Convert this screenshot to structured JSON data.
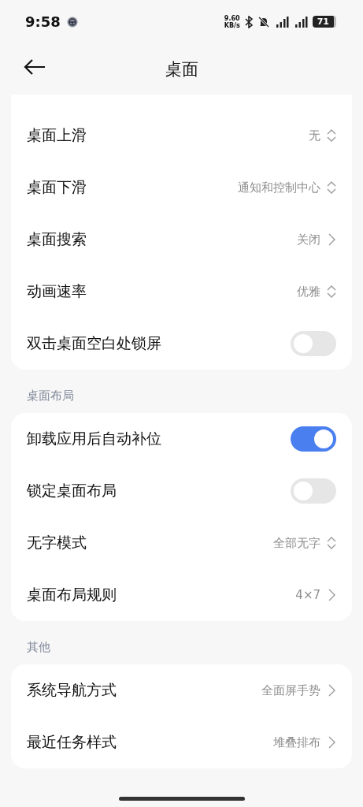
{
  "status_bar": {
    "time": "9:58",
    "net_speed": "9.60",
    "net_unit": "KB/s",
    "battery": "71"
  },
  "header": {
    "title": "桌面"
  },
  "sections": [
    {
      "rows": [
        {
          "kind": "select",
          "label": "桌面上滑",
          "value": "无"
        },
        {
          "kind": "select",
          "label": "桌面下滑",
          "value": "通知和控制中心"
        },
        {
          "kind": "link",
          "label": "桌面搜索",
          "value": "关闭"
        },
        {
          "kind": "select",
          "label": "动画速率",
          "value": "优雅"
        },
        {
          "kind": "toggle",
          "label": "双击桌面空白处锁屏",
          "on": false
        }
      ]
    },
    {
      "title": "桌面布局",
      "rows": [
        {
          "kind": "toggle",
          "label": "卸载应用后自动补位",
          "on": true
        },
        {
          "kind": "toggle",
          "label": "锁定桌面布局",
          "on": false
        },
        {
          "kind": "select",
          "label": "无字模式",
          "value": "全部无字"
        },
        {
          "kind": "link",
          "label": "桌面布局规则",
          "value": "4×7"
        }
      ]
    },
    {
      "title": "其他",
      "rows": [
        {
          "kind": "link",
          "label": "系统导航方式",
          "value": "全面屏手势"
        },
        {
          "kind": "link",
          "label": "最近任务样式",
          "value": "堆叠排布"
        }
      ]
    }
  ]
}
